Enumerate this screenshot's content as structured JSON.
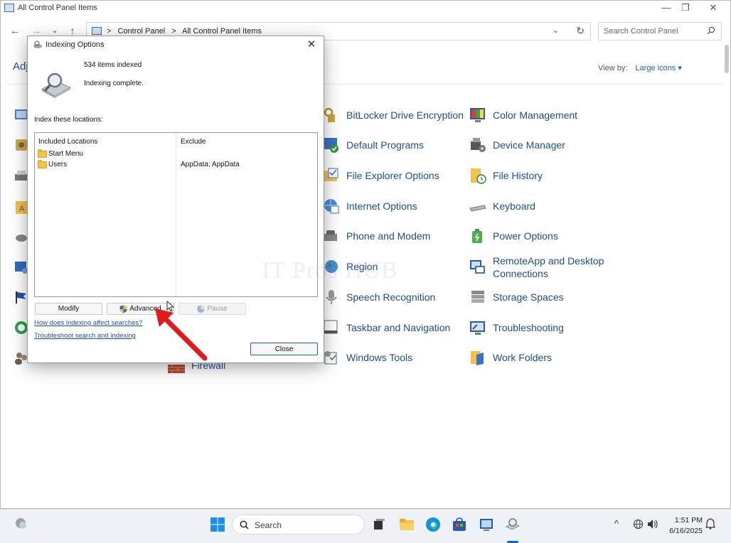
{
  "window": {
    "title": "All Control Panel Items",
    "controls": {
      "minimize": "—",
      "restore": "❐",
      "close": "✕"
    }
  },
  "nav": {
    "back": "←",
    "forward": "→",
    "recent": "⌄",
    "up": "↑",
    "breadcrumb": [
      "Control Panel",
      "All Control Panel Items"
    ],
    "crumb_sep": ">",
    "search_placeholder": "Search Control Panel"
  },
  "header": {
    "adjust_text": "Adj",
    "view_by_label": "View by:",
    "view_by_value": "Large icons ▾"
  },
  "control_panel_items": [
    {
      "label": "BitLocker Drive Encryption",
      "icon": "bitlocker-icon"
    },
    {
      "label": "Color Management",
      "icon": "color-management-icon"
    },
    {
      "label": "Default Programs",
      "icon": "default-programs-icon"
    },
    {
      "label": "Device Manager",
      "icon": "device-manager-icon"
    },
    {
      "label": "File Explorer Options",
      "icon": "file-explorer-options-icon"
    },
    {
      "label": "File History",
      "icon": "file-history-icon"
    },
    {
      "label": "Internet Options",
      "icon": "internet-options-icon"
    },
    {
      "label": "Keyboard",
      "icon": "keyboard-icon"
    },
    {
      "label": "Phone and Modem",
      "icon": "phone-modem-icon"
    },
    {
      "label": "Power Options",
      "icon": "power-options-icon"
    },
    {
      "label": "Region",
      "icon": "region-icon"
    },
    {
      "label": "RemoteApp and Desktop Connections",
      "icon": "remoteapp-icon"
    },
    {
      "label": "Speech Recognition",
      "icon": "speech-recognition-icon"
    },
    {
      "label": "Storage Spaces",
      "icon": "storage-spaces-icon"
    },
    {
      "label": "Taskbar and Navigation",
      "icon": "taskbar-navigation-icon"
    },
    {
      "label": "Troubleshooting",
      "icon": "troubleshooting-icon"
    },
    {
      "label": "Windows Tools",
      "icon": "windows-tools-icon"
    },
    {
      "label": "Work Folders",
      "icon": "work-folders-icon"
    },
    {
      "label": "Firewall",
      "icon": "firewall-icon"
    }
  ],
  "dialog": {
    "title": "Indexing Options",
    "items_indexed": "534 items indexed",
    "status": "Indexing complete.",
    "index_locations_label": "Index these locations:",
    "columns": {
      "included": "Included Locations",
      "exclude": "Exclude"
    },
    "locations": [
      {
        "name": "Start Menu",
        "exclude": ""
      },
      {
        "name": "Users",
        "exclude": "AppData; AppData"
      }
    ],
    "buttons": {
      "modify": "Modify",
      "advanced": "Advanced",
      "pause": "Pause",
      "close": "Close"
    },
    "links": {
      "how_affects": "How does indexing affect searches?",
      "troubleshoot": "Troubleshoot search and indexing"
    },
    "close_glyph": "✕"
  },
  "watermark": "IT Pros HUB",
  "taskbar": {
    "search_label": "Search",
    "tray_chevron": "^",
    "time": "1:51 PM",
    "date": "6/16/2025"
  },
  "colors": {
    "link": "#1f4e8c",
    "accent": "#1f63c6",
    "arrow": "#e01b1b"
  }
}
